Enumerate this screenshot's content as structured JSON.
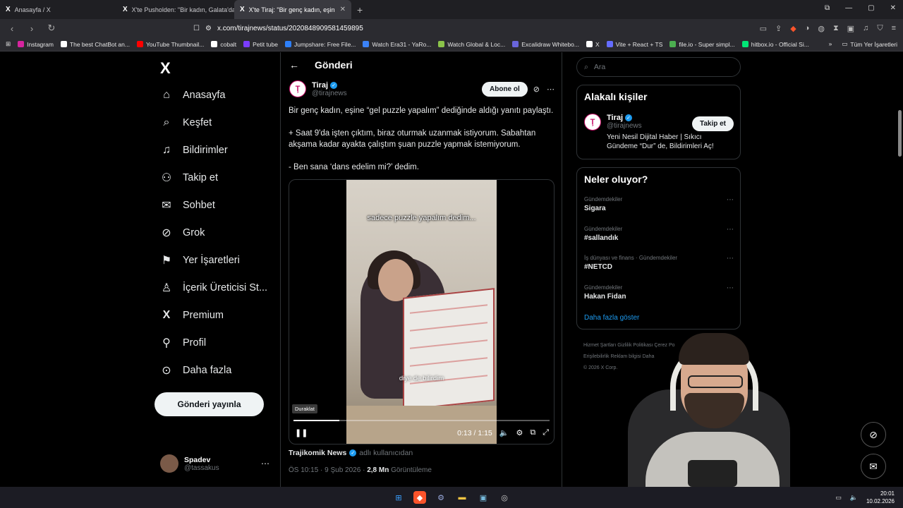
{
  "browser": {
    "tabs": [
      {
        "label": "Anasayfa / X",
        "active": false
      },
      {
        "label": "X'te Pusholden: \"Bir kadın, Galata'da",
        "active": false
      },
      {
        "label": "X'te Tiraj: \"Bir genç kadın, eşin",
        "active": true
      }
    ],
    "url": "x.com/tirajnews/status/2020848909581459895",
    "bookmarks": [
      {
        "label": "Instagram",
        "color": "#d6249f"
      },
      {
        "label": "The best ChatBot an...",
        "color": "#ffffff"
      },
      {
        "label": "YouTube Thumbnail...",
        "color": "#ff0000"
      },
      {
        "label": "cobalt",
        "color": "#ffffff"
      },
      {
        "label": "Petit tube",
        "color": "#7a3cff"
      },
      {
        "label": "Jumpshare: Free File...",
        "color": "#2d7ff9"
      },
      {
        "label": "Watch Era31 - YaRo...",
        "color": "#3b82f6"
      },
      {
        "label": "Watch Global & Loc...",
        "color": "#8bc34a"
      },
      {
        "label": "Excalidraw Whitebo...",
        "color": "#6965db"
      },
      {
        "label": "X",
        "color": "#ffffff"
      },
      {
        "label": "Vite + React + TS",
        "color": "#646cff"
      },
      {
        "label": "file.io - Super simpl...",
        "color": "#4caf50"
      },
      {
        "label": "hitbox.io - Official Si...",
        "color": "#00e676"
      }
    ],
    "all_bookmarks": "Tüm Yer İşaretleri"
  },
  "nav": {
    "items": [
      {
        "label": "Anasayfa",
        "icon": "home-icon",
        "glyph": "⌂"
      },
      {
        "label": "Keşfet",
        "icon": "search-icon",
        "glyph": "⌕"
      },
      {
        "label": "Bildirimler",
        "icon": "bell-icon",
        "glyph": "🔔"
      },
      {
        "label": "Takip et",
        "icon": "follow-icon",
        "glyph": "👤"
      },
      {
        "label": "Sohbet",
        "icon": "mail-icon",
        "glyph": "✉"
      },
      {
        "label": "Grok",
        "icon": "grok-icon",
        "glyph": "⊘"
      },
      {
        "label": "Yer İşaretleri",
        "icon": "bookmark-icon",
        "glyph": "🔖"
      },
      {
        "label": "İçerik Üreticisi St...",
        "icon": "creator-icon",
        "glyph": "♙"
      },
      {
        "label": "Premium",
        "icon": "x-premium-icon",
        "glyph": "X"
      },
      {
        "label": "Profil",
        "icon": "profile-icon",
        "glyph": "👤"
      },
      {
        "label": "Daha fazla",
        "icon": "more-icon",
        "glyph": "⋯"
      }
    ],
    "post_button": "Gönderi yayınla",
    "user": {
      "name": "Spadev",
      "handle": "@tassakus"
    }
  },
  "post": {
    "header": "Gönderi",
    "author_name": "Tiraj",
    "author_handle": "@tirajnews",
    "subscribe": "Abone ol",
    "text1": "Bir genç kadın, eşine “gel puzzle yapalım” dediğinde aldığı yanıtı paylaştı.",
    "text2": "+ Saat 9'da işten çıktım, biraz oturmak uzanmak istiyorum. Sabahtan akşama kadar ayakta çalıştım şuan puzzle yapmak istemiyorum.",
    "text3": "- Ben sana ‘dans edelim mi?’ dedim.",
    "video": {
      "caption_top": "sadece puzzle yapalım dedim...",
      "caption_bottom": "diye de bilirdim",
      "tooltip": "Duraklat",
      "time": "0:13 / 1:15",
      "progress": 0.18
    },
    "source": "Trajikomik News",
    "source_suffix": "adlı kullanıcıdan",
    "time": "ÖS 10:15 · 9 Şub 2026 ·",
    "views": "2,8 Mn",
    "views_label": "Görüntüleme"
  },
  "sidebar": {
    "search_placeholder": "Ara",
    "related_title": "Alakalı kişiler",
    "related_name": "Tiraj",
    "related_handle": "@tirajnews",
    "follow": "Takip et",
    "related_bio": "Yeni Nesil Dijital Haber | Sıkıcı Gündeme “Dur” de, Bildirimleri Aç!",
    "trends_title": "Neler oluyor?",
    "trends": [
      {
        "category": "Gündemdekiler",
        "name": "Sigara"
      },
      {
        "category": "Gündemdekiler",
        "name": "#sallandık"
      },
      {
        "category": "İş dünyası ve finans · Gündemdekiler",
        "name": "#NETCD"
      },
      {
        "category": "Gündemdekiler",
        "name": "Hakan Fidan"
      }
    ],
    "show_more": "Daha fazla göster",
    "footer1": "Hizmet Şartları    Gizlilik Politikası    Çerez Po",
    "footer2": "Erişilebilirlik    Reklam bilgisi    Daha",
    "footer3": "© 2026 X Corp."
  },
  "taskbar": {
    "time": "20:01",
    "date": "10.02.2026"
  }
}
